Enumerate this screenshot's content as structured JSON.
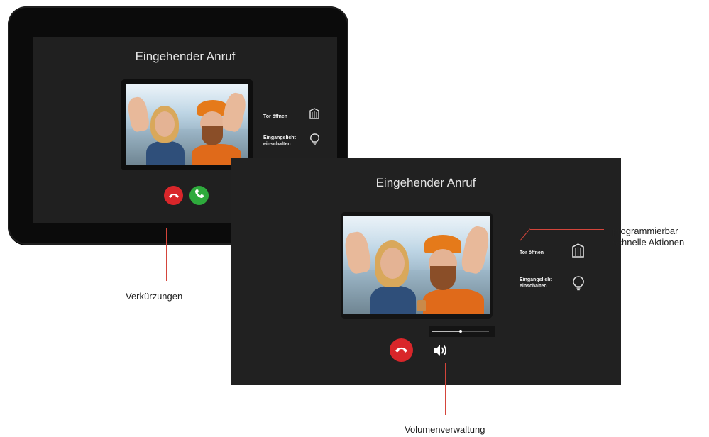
{
  "device_screen": {
    "title": "Eingehender Anruf",
    "actions": [
      {
        "label": "Tor öffnen",
        "icon": "gate-icon"
      },
      {
        "label": "Eingangslicht einschalten",
        "icon": "lightbulb-icon"
      }
    ],
    "buttons": [
      {
        "name": "decline-call",
        "icon": "phone-hangup-icon",
        "color": "#d9262a"
      },
      {
        "name": "accept-call",
        "icon": "phone-icon",
        "color": "#2eaa3c"
      }
    ]
  },
  "main_screen": {
    "title": "Eingehender Anruf",
    "actions": [
      {
        "label": "Tor öffnen",
        "icon": "gate-icon"
      },
      {
        "label": "Eingangslicht einschalten",
        "icon": "lightbulb-icon"
      }
    ],
    "volume": {
      "level": 0.5
    },
    "buttons": [
      {
        "name": "decline-call",
        "icon": "phone-hangup-icon",
        "color": "#d9262a"
      },
      {
        "name": "speaker",
        "icon": "speaker-icon"
      }
    ]
  },
  "callouts": {
    "shortcuts": "Verkürzungen",
    "quick_actions_line1": "programmierbar",
    "quick_actions_line2": "schnelle Aktionen",
    "volume": "Volumenverwaltung"
  },
  "colors": {
    "accent_line": "#d4453b",
    "screen_bg": "#212121"
  }
}
